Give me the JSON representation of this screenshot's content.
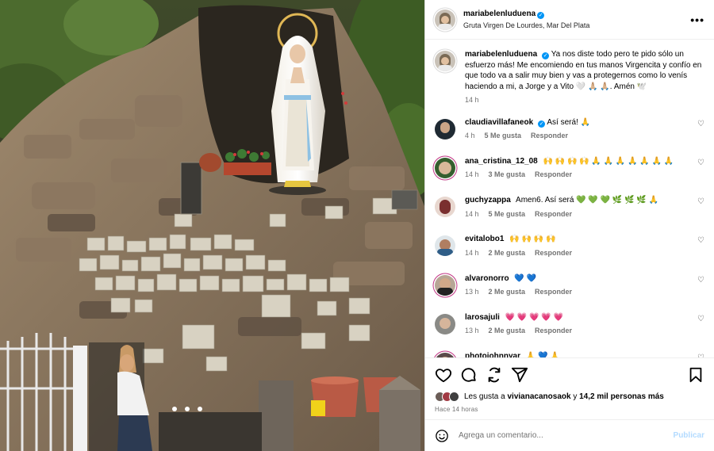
{
  "post": {
    "author": "mariabelenluduena",
    "location": "Gruta Virgen De Lourdes, Mar Del Plata",
    "more_icon": "more-horizontal-icon"
  },
  "caption": {
    "username": "mariabelenluduena",
    "text": "Ya nos diste todo pero te pido sólo un esfuerzo más! Me encomiendo en tus manos Virgencita y confío en que todo va a salir muy bien y vas a protegernos como lo venís haciendo a mi, a Jorge y a Vito 🤍 🙏🏼 🙏🏼. Amén 🕊️",
    "time": "14 h"
  },
  "comments": [
    {
      "username": "claudiavillafaneok",
      "verified": true,
      "text": "Así será! 🙏",
      "time": "4 h",
      "likes": "5 Me gusta",
      "reply": "Responder"
    },
    {
      "username": "ana_cristina_12_08",
      "verified": false,
      "text": "🙌 🙌 🙌 🙌 🙏 🙏 🙏 🙏 🙏 🙏 🙏",
      "time": "14 h",
      "likes": "3 Me gusta",
      "reply": "Responder"
    },
    {
      "username": "guchyzappa",
      "verified": false,
      "text": "Amen6. Así será 💚 💚 💚 🌿 🌿 🌿 🙏",
      "time": "14 h",
      "likes": "5 Me gusta",
      "reply": "Responder"
    },
    {
      "username": "evitalobo1",
      "verified": false,
      "text": "🙌 🙌 🙌 🙌",
      "time": "14 h",
      "likes": "2 Me gusta",
      "reply": "Responder"
    },
    {
      "username": "alvaronorro",
      "verified": false,
      "text": "💙 💙",
      "time": "13 h",
      "likes": "2 Me gusta",
      "reply": "Responder"
    },
    {
      "username": "larosajuli",
      "verified": false,
      "text": "💗 💗 💗 💗 💗",
      "time": "13 h",
      "likes": "2 Me gusta",
      "reply": "Responder"
    },
    {
      "username": "photojohnnyar",
      "verified": false,
      "text": "🙏 💙 🙏",
      "time": "",
      "likes": "",
      "reply": ""
    }
  ],
  "actions": {
    "like_icon": "heart-icon",
    "comment_icon": "comment-icon",
    "share_icon": "share-icon",
    "send_icon": "send-icon",
    "save_icon": "bookmark-icon"
  },
  "likes": {
    "prefix": "Les gusta a",
    "user": "vivianacanosaok",
    "middle": "y",
    "others": "14,2 mil personas más"
  },
  "posted_ago": "Hace 14 horas",
  "composer": {
    "emoji_icon": "emoji-icon",
    "placeholder": "Agrega un comentario...",
    "publish": "Publicar"
  },
  "colors": {
    "accent": "#0095f6",
    "publish_disabled": "#b3dbff",
    "muted": "#737373"
  }
}
